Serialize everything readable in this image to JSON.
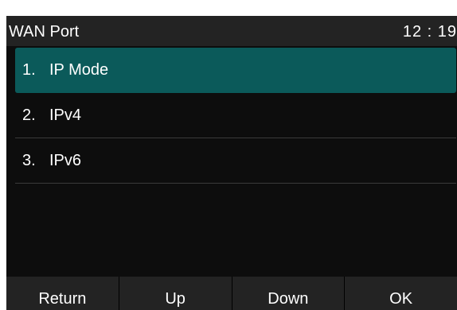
{
  "header": {
    "title": "WAN Port",
    "time": "12 : 19"
  },
  "menu": {
    "selected_index": 0,
    "items": [
      {
        "number": "1.",
        "label": "IP Mode"
      },
      {
        "number": "2.",
        "label": "IPv4"
      },
      {
        "number": "3.",
        "label": "IPv6"
      }
    ]
  },
  "softkeys": {
    "return_label": "Return",
    "up_label": "Up",
    "down_label": "Down",
    "ok_label": "OK"
  },
  "colors": {
    "selection": "#0b5a5a",
    "background": "#0d0d0d",
    "bar": "#232323",
    "text": "#ffffff"
  }
}
